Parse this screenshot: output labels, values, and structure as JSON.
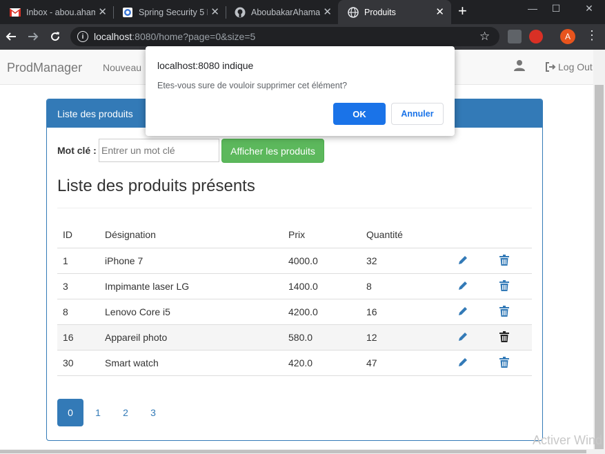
{
  "browser": {
    "tabs": [
      {
        "title": "Inbox - abou.aham",
        "icon": "gmail-icon"
      },
      {
        "title": "Spring Security 5 L",
        "icon": "spring-page-icon"
      },
      {
        "title": "AboubakarAhama",
        "icon": "github-icon"
      },
      {
        "title": "Produits",
        "icon": "globe-icon",
        "active": true
      }
    ],
    "url_host": "localhost",
    "url_rest": ":8080/home?page=0&size=5"
  },
  "navbar": {
    "brand": "ProdManager",
    "link_new": "Nouveau",
    "logout": "Log Out"
  },
  "panel": {
    "heading": "Liste des produits",
    "search_label": "Mot clé :",
    "search_placeholder": "Entrer un mot clé",
    "search_button": "Afficher les produits",
    "list_title": "Liste des produits présents"
  },
  "table": {
    "headers": [
      "ID",
      "Désignation",
      "Prix",
      "Quantité"
    ],
    "rows": [
      {
        "id": "1",
        "designation": "iPhone 7",
        "prix": "4000.0",
        "quantite": "32"
      },
      {
        "id": "3",
        "designation": "Impimante laser LG",
        "prix": "1400.0",
        "quantite": "8"
      },
      {
        "id": "8",
        "designation": "Lenovo Core i5",
        "prix": "4200.0",
        "quantite": "16"
      },
      {
        "id": "16",
        "designation": "Appareil photo",
        "prix": "580.0",
        "quantite": "12"
      },
      {
        "id": "30",
        "designation": "Smart watch",
        "prix": "420.0",
        "quantite": "47"
      }
    ]
  },
  "pagination": {
    "pages": [
      "0",
      "1",
      "2",
      "3"
    ],
    "current_page": "0"
  },
  "dialog": {
    "title": "localhost:8080 indique",
    "message": "Etes-vous sure de vouloir supprimer cet élément?",
    "ok": "OK",
    "cancel": "Annuler"
  },
  "watermark": "Activer Wind",
  "colors": {
    "primary": "#337ab7",
    "success": "#5cb85c",
    "dialog_button": "#1a73e8",
    "chrome_dark": "#202124"
  }
}
